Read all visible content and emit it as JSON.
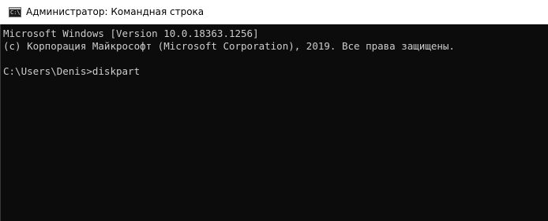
{
  "window": {
    "title": "Администратор: Командная строка",
    "icon": "cmd-icon",
    "icon_glyph": "C:\\"
  },
  "console": {
    "lines": [
      "Microsoft Windows [Version 10.0.18363.1256]",
      "(c) Корпорация Майкрософт (Microsoft Corporation), 2019. Все права защищены.",
      "C:\\Users\\Denis>diskpart"
    ]
  },
  "colors": {
    "console_background": "#0c0c0c",
    "console_text": "#cccccc",
    "titlebar_background": "#ffffff"
  }
}
